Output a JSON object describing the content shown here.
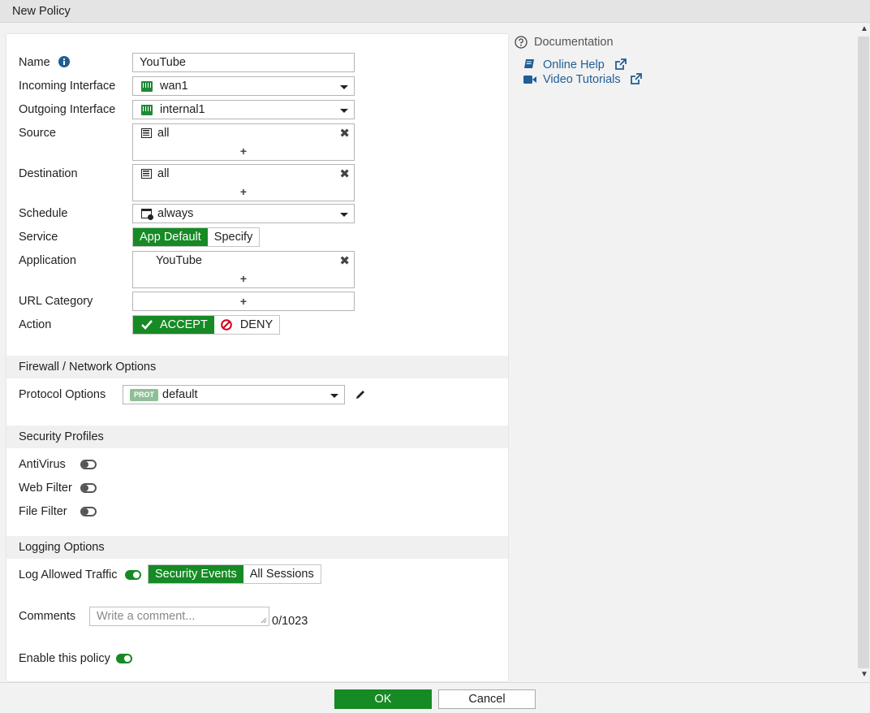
{
  "window": {
    "title": "New Policy"
  },
  "form": {
    "name_label": "Name",
    "name_value": "YouTube",
    "incoming_label": "Incoming Interface",
    "incoming_value": "wan1",
    "outgoing_label": "Outgoing Interface",
    "outgoing_value": "internal1",
    "source_label": "Source",
    "source_value": "all",
    "destination_label": "Destination",
    "destination_value": "all",
    "schedule_label": "Schedule",
    "schedule_value": "always",
    "service_label": "Service",
    "service_options": [
      "App Default",
      "Specify"
    ],
    "application_label": "Application",
    "application_value": "YouTube",
    "url_category_label": "URL Category",
    "action_label": "Action",
    "action_accept": "ACCEPT",
    "action_deny": "DENY",
    "add_symbol": "+",
    "remove_symbol": "✖"
  },
  "firewall": {
    "section_title": "Firewall / Network Options",
    "protocol_label": "Protocol Options",
    "protocol_badge": "PROT",
    "protocol_value": "default"
  },
  "security": {
    "section_title": "Security Profiles",
    "antivirus_label": "AntiVirus",
    "webfilter_label": "Web Filter",
    "filefilter_label": "File Filter"
  },
  "logging": {
    "section_title": "Logging Options",
    "log_label": "Log Allowed Traffic",
    "log_options": [
      "Security Events",
      "All Sessions"
    ],
    "comments_label": "Comments",
    "comments_placeholder": "Write a comment...",
    "comments_count": "0/1023",
    "enable_label": "Enable this policy"
  },
  "documentation": {
    "title": "Documentation",
    "online_help": "Online Help",
    "video_tutorials": "Video Tutorials"
  },
  "footer": {
    "ok": "OK",
    "cancel": "Cancel"
  },
  "colors": {
    "accent_green": "#168a24",
    "link_blue": "#1f5e96",
    "deny_red": "#d0021b"
  }
}
